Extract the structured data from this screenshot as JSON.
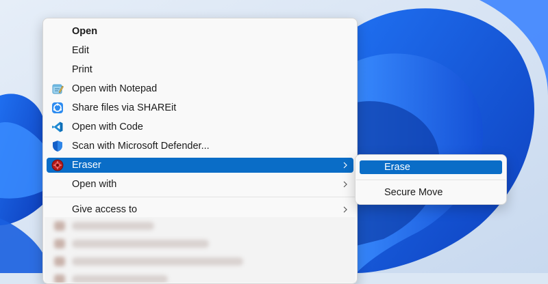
{
  "menu": {
    "items": [
      {
        "label": "Open",
        "icon": "none",
        "bold": true
      },
      {
        "label": "Edit",
        "icon": "none"
      },
      {
        "label": "Print",
        "icon": "none"
      },
      {
        "label": "Open with Notepad",
        "icon": "notepad-icon"
      },
      {
        "label": "Share files via SHAREit",
        "icon": "shareit-icon"
      },
      {
        "label": "Open with Code",
        "icon": "vscode-icon"
      },
      {
        "label": "Scan with Microsoft Defender...",
        "icon": "defender-shield-icon"
      },
      {
        "label": "Eraser",
        "icon": "eraser-icon",
        "selected": true,
        "has_submenu": true
      },
      {
        "label": "Open with",
        "icon": "none",
        "has_submenu": true
      },
      {
        "label": "Give access to",
        "icon": "none",
        "has_submenu": true
      }
    ]
  },
  "submenu": {
    "items": [
      {
        "label": "Erase",
        "selected": true
      },
      {
        "label": "Secure Move"
      }
    ]
  },
  "colors": {
    "selection": "#0a6dc7",
    "wallpaper": "#1a5fe0"
  }
}
